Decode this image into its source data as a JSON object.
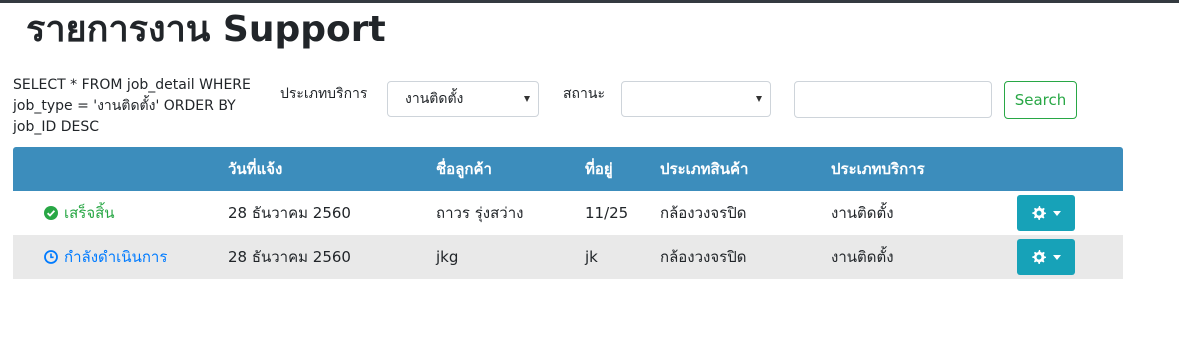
{
  "page": {
    "title": "รายการงาน Support",
    "sql": "SELECT * FROM job_detail WHERE job_type = 'งานติดตั้ง' ORDER BY job_ID DESC"
  },
  "filters": {
    "service_type_label": "ประเภทบริการ",
    "service_type_value": "งานติดตั้ง",
    "status_label": "สถานะ",
    "status_value": "",
    "search_value": "",
    "search_button": "Search"
  },
  "table": {
    "headers": [
      "",
      "วันที่แจ้ง",
      "ชื่อลูกค้า",
      "ที่อยู่",
      "ประเภทสินค้า",
      "ประเภทบริการ",
      ""
    ],
    "rows": [
      {
        "status": "เสร็จสิ้น",
        "status_icon": "check-circle-icon",
        "status_color": "#28a745",
        "date": "28 ธันวาคม 2560",
        "customer": "ถาวร รุ่งสว่าง",
        "address": "11/25",
        "product_type": "กล้องวงจรปิด",
        "service_type": "งานติดตั้ง"
      },
      {
        "status": "กำลังดำเนินการ",
        "status_icon": "clock-icon",
        "status_color": "#007bff",
        "date": "28 ธันวาคม 2560",
        "customer": "jkg",
        "address": "jk",
        "product_type": "กล้องวงจรปิด",
        "service_type": "งานติดตั้ง"
      }
    ]
  },
  "colors": {
    "header_bg": "#3c8dbc",
    "action_button": "#17a2b8",
    "search_border": "#28a745"
  }
}
